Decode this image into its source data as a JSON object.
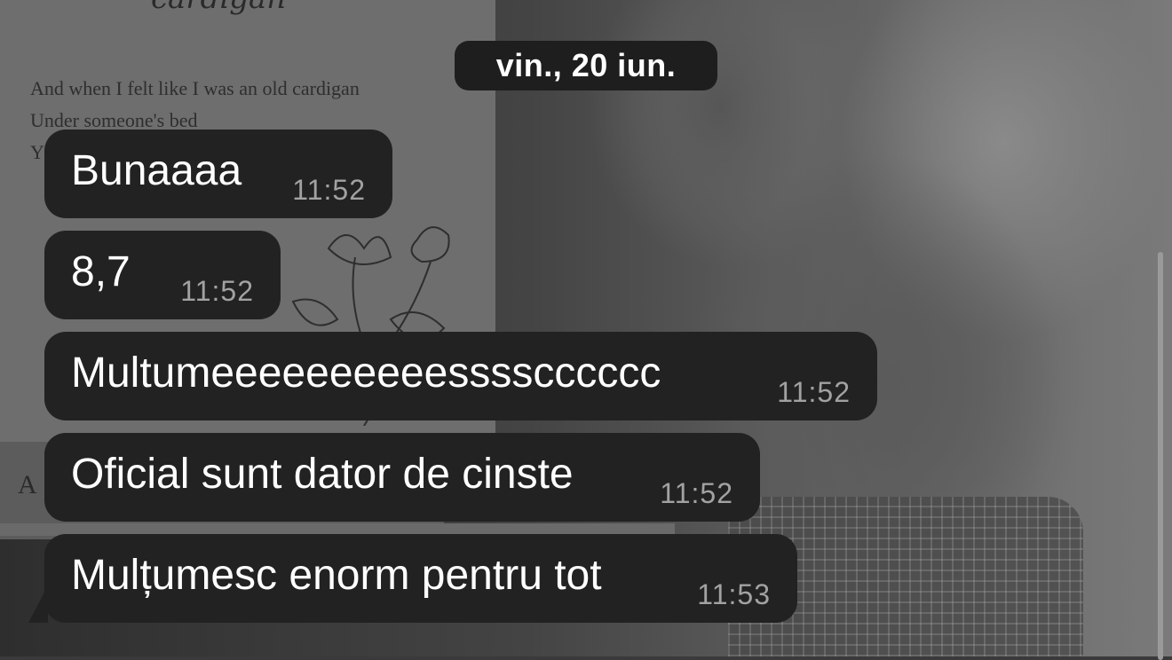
{
  "wallpaper": {
    "paper_title": "cardigan",
    "lyrics": "And when I felt like I was an old cardigan\nUnder someone's bed\nY                                                      rite",
    "letter": "A"
  },
  "date_header": "vin., 20 iun.",
  "messages": [
    {
      "text": "Bunaaaa",
      "time": "11:52"
    },
    {
      "text": "8,7",
      "time": "11:52"
    },
    {
      "text": "Multumeeeeeeeeeesssscccccc",
      "time": "11:52"
    },
    {
      "text": "Oficial sunt dator de cinste",
      "time": "11:52"
    },
    {
      "text": "Mulțumesc enorm pentru tot",
      "time": "11:53"
    }
  ],
  "colors": {
    "bubble": "#222222",
    "text": "#ffffff",
    "time": "#a2a2a2",
    "date_pill": "#1e1e1e"
  }
}
